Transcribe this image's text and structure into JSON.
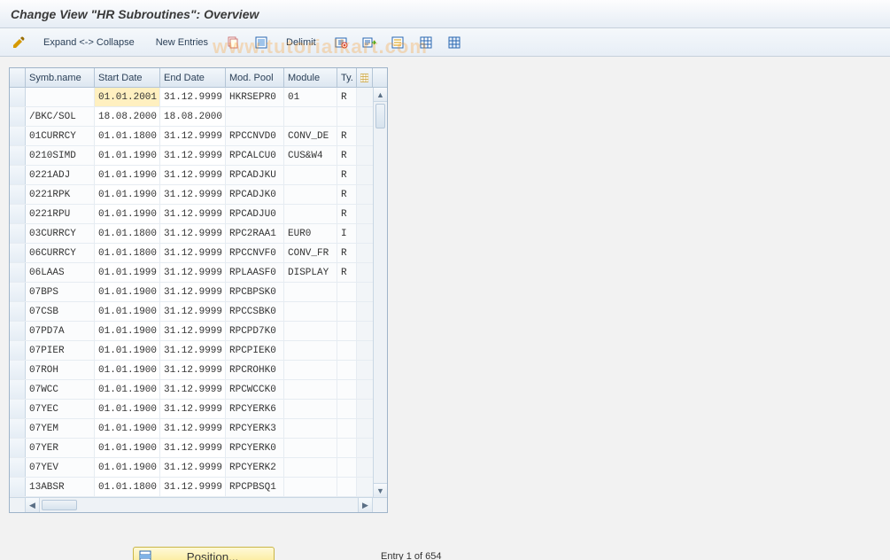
{
  "title": "Change View \"HR Subroutines\": Overview",
  "watermark": "www.tutorialkart.com",
  "toolbar": {
    "expand_collapse": "Expand <-> Collapse",
    "new_entries": "New Entries",
    "delimit": "Delimit"
  },
  "columns": {
    "symb_name": "Symb.name",
    "start_date": "Start Date",
    "end_date": "End Date",
    "mod_pool": "Mod. Pool",
    "module": "Module",
    "ty": "Ty."
  },
  "rows": [
    {
      "name": "",
      "sd": "01.01.2001",
      "ed": "31.12.9999",
      "mp": "HKRSEPR0",
      "mod": "01",
      "ty": "R",
      "hl_sd": true
    },
    {
      "name": "/BKC/SOL",
      "sd": "18.08.2000",
      "ed": "18.08.2000",
      "mp": "",
      "mod": "",
      "ty": ""
    },
    {
      "name": "01CURRCY",
      "sd": "01.01.1800",
      "ed": "31.12.9999",
      "mp": "RPCCNVD0",
      "mod": "CONV_DE",
      "ty": "R"
    },
    {
      "name": "0210SIMD",
      "sd": "01.01.1990",
      "ed": "31.12.9999",
      "mp": "RPCALCU0",
      "mod": "CUS&W4",
      "ty": "R"
    },
    {
      "name": "0221ADJ",
      "sd": "01.01.1990",
      "ed": "31.12.9999",
      "mp": "RPCADJKU",
      "mod": "",
      "ty": "R"
    },
    {
      "name": "0221RPK",
      "sd": "01.01.1990",
      "ed": "31.12.9999",
      "mp": "RPCADJK0",
      "mod": "",
      "ty": "R"
    },
    {
      "name": "0221RPU",
      "sd": "01.01.1990",
      "ed": "31.12.9999",
      "mp": "RPCADJU0",
      "mod": "",
      "ty": "R"
    },
    {
      "name": "03CURRCY",
      "sd": "01.01.1800",
      "ed": "31.12.9999",
      "mp": "RPC2RAA1",
      "mod": "EUR0",
      "ty": "I"
    },
    {
      "name": "06CURRCY",
      "sd": "01.01.1800",
      "ed": "31.12.9999",
      "mp": "RPCCNVF0",
      "mod": "CONV_FR",
      "ty": "R"
    },
    {
      "name": "06LAAS",
      "sd": "01.01.1999",
      "ed": "31.12.9999",
      "mp": "RPLAASF0",
      "mod": "DISPLAY",
      "ty": "R"
    },
    {
      "name": "07BPS",
      "sd": "01.01.1900",
      "ed": "31.12.9999",
      "mp": "RPCBPSK0",
      "mod": "",
      "ty": ""
    },
    {
      "name": "07CSB",
      "sd": "01.01.1900",
      "ed": "31.12.9999",
      "mp": "RPCCSBK0",
      "mod": "",
      "ty": ""
    },
    {
      "name": "07PD7A",
      "sd": "01.01.1900",
      "ed": "31.12.9999",
      "mp": "RPCPD7K0",
      "mod": "",
      "ty": ""
    },
    {
      "name": "07PIER",
      "sd": "01.01.1900",
      "ed": "31.12.9999",
      "mp": "RPCPIEK0",
      "mod": "",
      "ty": ""
    },
    {
      "name": "07ROH",
      "sd": "01.01.1900",
      "ed": "31.12.9999",
      "mp": "RPCROHK0",
      "mod": "",
      "ty": ""
    },
    {
      "name": "07WCC",
      "sd": "01.01.1900",
      "ed": "31.12.9999",
      "mp": "RPCWCCK0",
      "mod": "",
      "ty": ""
    },
    {
      "name": "07YEC",
      "sd": "01.01.1900",
      "ed": "31.12.9999",
      "mp": "RPCYERK6",
      "mod": "",
      "ty": ""
    },
    {
      "name": "07YEM",
      "sd": "01.01.1900",
      "ed": "31.12.9999",
      "mp": "RPCYERK3",
      "mod": "",
      "ty": ""
    },
    {
      "name": "07YER",
      "sd": "01.01.1900",
      "ed": "31.12.9999",
      "mp": "RPCYERK0",
      "mod": "",
      "ty": ""
    },
    {
      "name": "07YEV",
      "sd": "01.01.1900",
      "ed": "31.12.9999",
      "mp": "RPCYERK2",
      "mod": "",
      "ty": ""
    },
    {
      "name": "13ABSR",
      "sd": "01.01.1800",
      "ed": "31.12.9999",
      "mp": "RPCPBSQ1",
      "mod": "",
      "ty": ""
    }
  ],
  "footer": {
    "position_label": "Position...",
    "entry_status": "Entry 1 of 654"
  }
}
